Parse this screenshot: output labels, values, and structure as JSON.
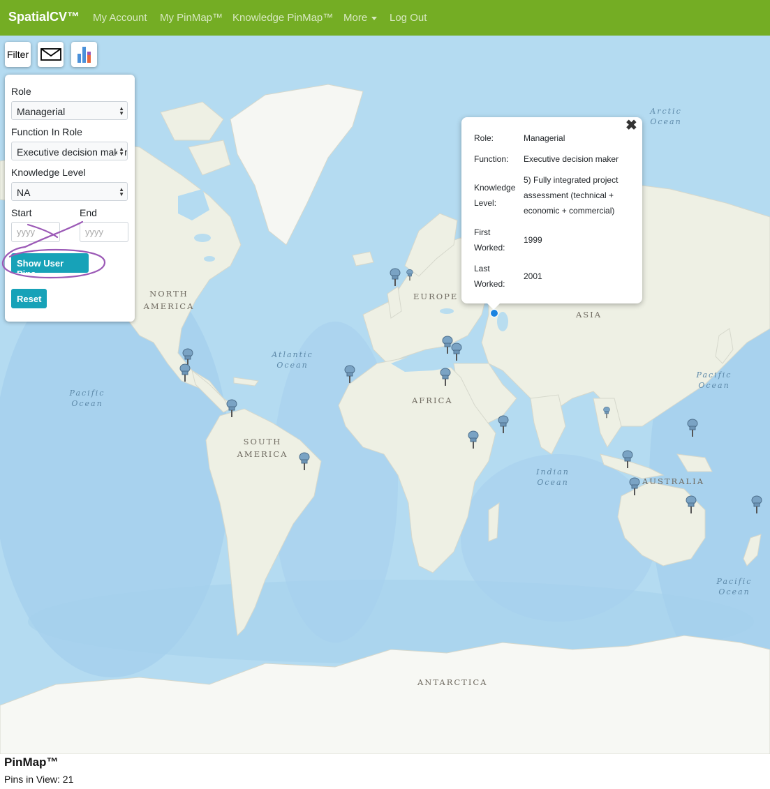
{
  "navbar": {
    "brand": "SpatialCV™",
    "links": [
      "My Account",
      "My PinMap™",
      "Knowledge PinMap™",
      "More",
      "Log Out"
    ]
  },
  "toolbar": {
    "filter_label": "Filter",
    "mail_icon": "envelope-icon",
    "chart_icon": "bar-chart-icon"
  },
  "filter": {
    "role_label": "Role",
    "role_value": "Managerial",
    "function_label": "Function In Role",
    "function_value": "Executive decision maker",
    "knowledge_label": "Knowledge Level",
    "knowledge_value": "NA",
    "start_label": "Start",
    "end_label": "End",
    "start_placeholder": "yyyy",
    "end_placeholder": "yyyy",
    "show_pins_label": "Show User Pins",
    "reset_label": "Reset"
  },
  "popup": {
    "role_key": "Role:",
    "role_val": "Managerial",
    "function_key": "Function:",
    "function_val": "Executive decision maker",
    "knowledge_key_1": "Knowledge",
    "knowledge_key_2": "Level:",
    "knowledge_val_1": "5) Fully integrated project",
    "knowledge_val_2": "assessment (technical +",
    "knowledge_val_3": "economic + commercial)",
    "first_key_1": "First",
    "first_key_2": "Worked:",
    "first_val": "1999",
    "last_key_1": "Last",
    "last_key_2": "Worked:",
    "last_val": "2001",
    "close_icon": "close-icon"
  },
  "map_labels": {
    "north_america_1": "NORTH",
    "north_america_2": "AMERICA",
    "south_america_1": "SOUTH",
    "south_america_2": "AMERICA",
    "europe": "EUROPE",
    "asia": "ASIA",
    "africa": "AFRICA",
    "australia": "AUSTRALIA",
    "antarctica": "ANTARCTICA",
    "arctic_1": "Arctic",
    "arctic_2": "Ocean",
    "atlantic_1": "Atlantic",
    "atlantic_2": "Ocean",
    "pacific_w_1": "Pacific",
    "pacific_w_2": "Ocean",
    "pacific_e_1": "Pacific",
    "pacific_e_2": "Ocean",
    "pacific_se_1": "Pacific",
    "pacific_se_2": "Ocean",
    "indian_1": "Indian",
    "indian_2": "Ocean"
  },
  "footer": {
    "title": "PinMap™",
    "pins_in_view": "Pins in View: 21"
  },
  "colors": {
    "navbar": "#74ad24",
    "button": "#17a2b8",
    "annotation": "#9b59b6",
    "ocean": "#a9d3ec",
    "land": "#eef0e4"
  }
}
